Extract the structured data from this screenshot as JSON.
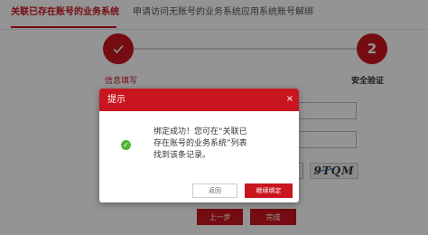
{
  "tabs": [
    {
      "label": "关联已存在账号的业务系统",
      "active": true
    },
    {
      "label": "申请访问无账号的业务系统",
      "active": false
    },
    {
      "label": "应用系统账号解绑",
      "active": false
    }
  ],
  "stepper": {
    "step1": {
      "label": "信息填写",
      "icon": "check-icon"
    },
    "step2": {
      "number": "2",
      "label": "安全验证"
    }
  },
  "captcha": {
    "text": "9TQM"
  },
  "background_buttons": {
    "prev": "上一步",
    "done": "完成"
  },
  "modal": {
    "title": "提示",
    "close": "×",
    "icon": "success-check-icon",
    "message_lines": [
      "绑定成功！您可在“关联已",
      "存在账号的业务系统”列表",
      "找到该条记录。"
    ],
    "back_label": "返回",
    "continue_label": "继续绑定"
  },
  "colors": {
    "brand": "#c9151e",
    "success": "#52b635"
  }
}
